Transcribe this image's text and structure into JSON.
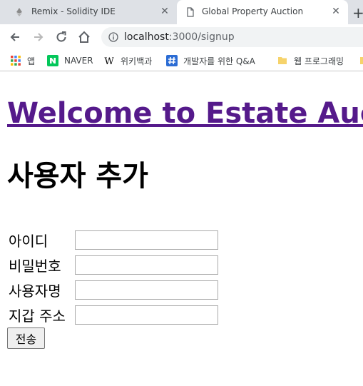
{
  "browser": {
    "tabs": [
      {
        "title": "Remix - Solidity IDE",
        "active": false
      },
      {
        "title": "Global Property Auction",
        "active": true
      }
    ],
    "address": {
      "host": "localhost",
      "path": ":3000/signup"
    },
    "bookmarks": [
      {
        "label": "앱",
        "icon": "apps-grid-icon"
      },
      {
        "label": "NAVER",
        "icon": "naver-icon"
      },
      {
        "label": "위키백과",
        "icon": "wikipedia-icon"
      },
      {
        "label": "개발자를 위한 Q&A",
        "icon": "hashtag-icon"
      },
      {
        "label": "웹 프로그래밍",
        "icon": "folder-icon"
      }
    ]
  },
  "page": {
    "welcome_link": "Welcome to Estate Auction",
    "heading": "사용자 추가",
    "fields": [
      {
        "label": "아이디",
        "value": ""
      },
      {
        "label": "비밀번호",
        "value": ""
      },
      {
        "label": "사용자명",
        "value": ""
      },
      {
        "label": "지갑 주소",
        "value": ""
      }
    ],
    "submit_label": "전송"
  },
  "colors": {
    "visited_link": "#551a8b",
    "tab_strip": "#dee1e6",
    "omnibox": "#f1f3f4"
  }
}
